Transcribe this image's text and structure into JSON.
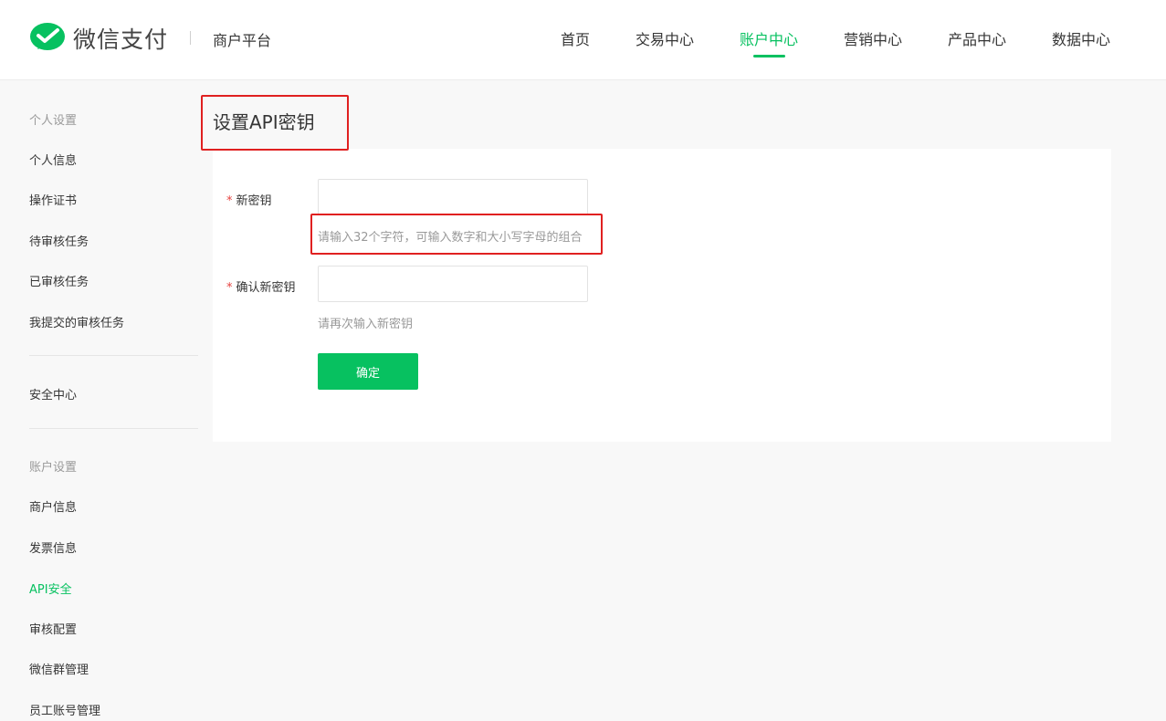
{
  "header": {
    "logo_text": "微信支付",
    "platform": "商户平台",
    "nav": [
      {
        "label": "首页"
      },
      {
        "label": "交易中心"
      },
      {
        "label": "账户中心"
      },
      {
        "label": "营销中心"
      },
      {
        "label": "产品中心"
      },
      {
        "label": "数据中心"
      }
    ],
    "active_nav": "账户中心"
  },
  "sidebar": {
    "groups": [
      {
        "title": "个人设置",
        "items": [
          "个人信息",
          "操作证书",
          "待审核任务",
          "已审核任务",
          "我提交的审核任务"
        ]
      },
      {
        "title": "",
        "items": [
          "安全中心"
        ]
      },
      {
        "title": "账户设置",
        "items": [
          "商户信息",
          "发票信息",
          "API安全",
          "审核配置",
          "微信群管理",
          "员工账号管理"
        ]
      }
    ],
    "active_item": "API安全"
  },
  "main": {
    "title": "设置API密钥",
    "form": {
      "new_key": {
        "required_mark": "*",
        "label": "新密钥",
        "value": "",
        "hint": "请输入32个字符，可输入数字和大小写字母的组合"
      },
      "confirm_key": {
        "required_mark": "*",
        "label": "确认新密钥",
        "value": "",
        "hint": "请再次输入新密钥"
      },
      "submit_label": "确定"
    }
  },
  "colors": {
    "brand": "#07c160",
    "highlight_box": "#e02020",
    "required": "#e64340"
  }
}
